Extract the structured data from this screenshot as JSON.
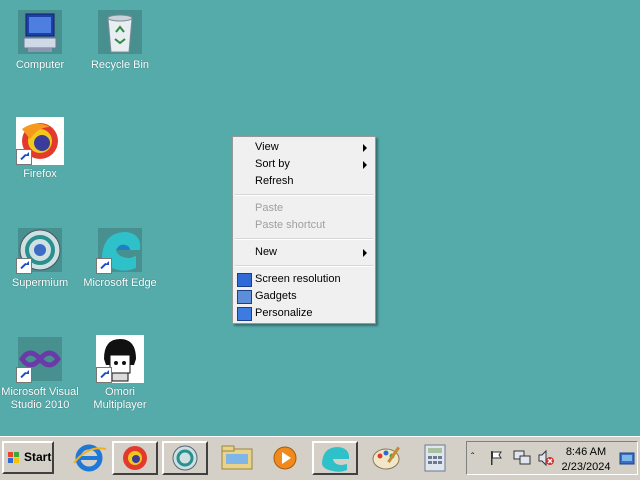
{
  "desktop": {
    "icons": [
      {
        "label": "Computer"
      },
      {
        "label": "Recycle Bin"
      },
      {
        "label": "Firefox"
      },
      {
        "label": "Supermium"
      },
      {
        "label": "Microsoft Edge"
      },
      {
        "label": "Microsoft Visual Studio 2010"
      },
      {
        "label": "Omori Multiplayer"
      }
    ]
  },
  "context_menu": {
    "items": [
      {
        "label": "View",
        "submenu": true,
        "enabled": true
      },
      {
        "label": "Sort by",
        "submenu": true,
        "enabled": true
      },
      {
        "label": "Refresh",
        "enabled": true
      },
      {
        "label": "Paste",
        "enabled": false
      },
      {
        "label": "Paste shortcut",
        "enabled": false
      },
      {
        "label": "New",
        "submenu": true,
        "enabled": true
      },
      {
        "label": "Screen resolution",
        "icon": "display-icon",
        "enabled": true
      },
      {
        "label": "Gadgets",
        "icon": "gadgets-icon",
        "enabled": true
      },
      {
        "label": "Personalize",
        "icon": "personalize-icon",
        "enabled": true
      }
    ]
  },
  "taskbar": {
    "start_label": "Start",
    "pinned": [
      "internet-explorer-icon",
      "firefox-icon",
      "supermium-icon",
      "file-explorer-icon",
      "media-player-icon",
      "edge-icon",
      "paint-icon",
      "calculator-icon"
    ],
    "tray": {
      "time": "8:46 AM",
      "date": "2/23/2024",
      "icons": [
        "show-hidden-icons-icon",
        "action-center-flag-icon",
        "network-icon",
        "volume-muted-icon",
        "desktop-icon"
      ]
    }
  },
  "colors": {
    "desktop": "#55aaaa",
    "taskbar": "#d4d0c8",
    "menu": "#f0f0f0"
  }
}
